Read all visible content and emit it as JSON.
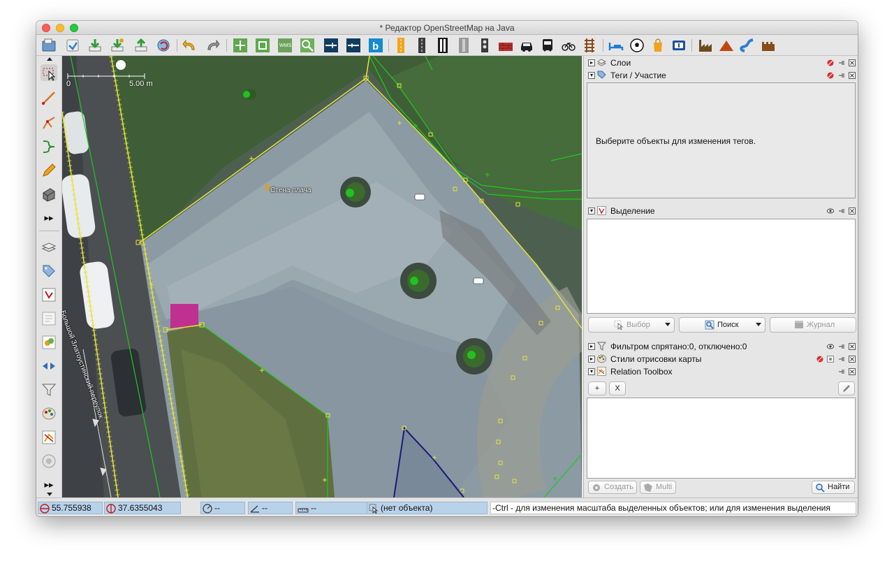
{
  "window": {
    "title": "* Редактор OpenStreetMap на Java"
  },
  "toolbar": {
    "icons": [
      "open-file-icon",
      "save-icon",
      "download-icon",
      "download-data-icon",
      "upload-icon",
      "update-icon",
      "undo-icon",
      "redo-icon",
      "zoom-to-data-icon",
      "zoom-to-selection-icon",
      "wms-imagery-icon",
      "search-zoom-icon",
      "road-preset-icon",
      "path-preset-icon",
      "bing-imagery-icon",
      "highway-preset-icon",
      "track-preset-icon",
      "rail-preset-icon",
      "platform-preset-icon",
      "traffic-light-icon",
      "barrier-icon",
      "car-icon",
      "bus-icon",
      "bicycle-icon",
      "railway-icon",
      "hotel-icon",
      "sports-icon",
      "shop-icon",
      "information-icon",
      "industrial-icon",
      "peak-icon",
      "waterway-icon",
      "castle-icon"
    ]
  },
  "left_tools": [
    "select-tool-icon",
    "draw-line-icon",
    "split-way-icon",
    "improve-way-icon",
    "pencil-icon",
    "building-tool-icon",
    "more-tools-icon",
    "layers-toggle-icon",
    "tags-toggle-icon",
    "selection-toggle-icon",
    "history-toggle-icon",
    "conflicts-toggle-icon",
    "validation-toggle-icon",
    "filter-toggle-icon",
    "map-style-toggle-icon",
    "relation-toolbox-toggle-icon",
    "changeset-toggle-icon",
    "more-toggles-icon"
  ],
  "map": {
    "scale_zero": "0",
    "scale_label": "5.00 m",
    "poi_label": "Стена плача",
    "street_label": "Большой Златоустинский переулок"
  },
  "panels": {
    "layers": {
      "title": "Слои"
    },
    "tags": {
      "title": "Теги / Участие",
      "hint": "Выберите объекты для изменения тегов."
    },
    "selection": {
      "title": "Выделение",
      "select_btn": "Выбор",
      "search_btn": "Поиск",
      "history_btn": "Журнал"
    },
    "filter": {
      "title": "Фильтром спрятано:0, отключено:0"
    },
    "styles": {
      "title": "Стили отрисовки карты"
    },
    "relation_toolbox": {
      "title": "Relation Toolbox",
      "add_btn": "+",
      "x_btn": "X",
      "create_btn": "Создать",
      "multi_btn": "Multi",
      "find_btn": "Найти"
    }
  },
  "status": {
    "lat": "55.755938",
    "lon": "37.6355043",
    "heading": "--",
    "angle": "--",
    "length": "--",
    "object": "(нет объекта)",
    "message": "-Ctrl - для изменения масштаба выделенных объектов; или для изменения выделения"
  },
  "colors": {
    "accent": "#b8d2ea",
    "osm_way_yellow": "#e4e43a",
    "osm_way_green": "#1ec81e",
    "osm_selected_blue": "#1a1a7a"
  }
}
